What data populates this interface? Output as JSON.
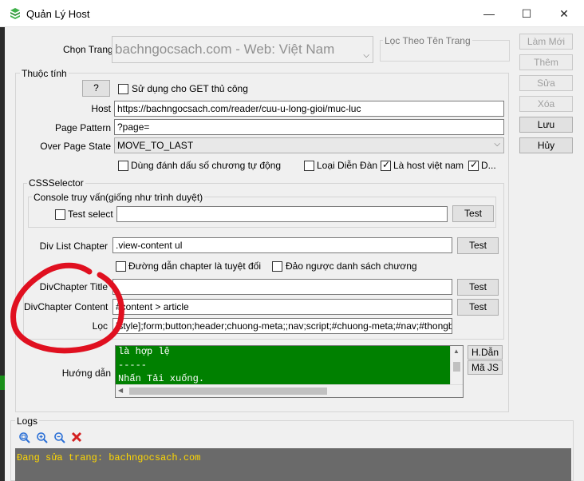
{
  "window": {
    "title": "Quản Lý Host",
    "minimize": "—",
    "maximize": "☐",
    "close": "✕"
  },
  "top": {
    "page_label": "Chọn Trang",
    "page_value": "bachngocsach.com - Web: Việt Nam",
    "filter_label": "Lọc Theo Tên Trang",
    "filter_value": ""
  },
  "side_buttons": {
    "new": "Làm Mới",
    "add": "Thêm",
    "edit": "Sửa",
    "delete": "Xóa",
    "save": "Lưu",
    "cancel": "Hủy"
  },
  "props": {
    "group_label": "Thuộc tính",
    "help_button": "?",
    "manual_get_label": "Sử dụng cho GET thủ công",
    "host_label": "Host",
    "host_value": "https://bachngocsach.com/reader/cuu-u-long-gioi/muc-luc",
    "page_pattern_label": "Page Pattern",
    "page_pattern_value": "?page=",
    "over_page_state_label": "Over Page State",
    "over_page_state_value": "MOVE_TO_LAST",
    "auto_number_label": "Dùng đánh dấu số chương tự động",
    "remove_forum_label": "Loại Diễn Đàn",
    "vn_host_label": "Là host việt nam",
    "d_label": "D..."
  },
  "css": {
    "group_label": "CSSSelector",
    "console_label": "Console truy vấn(giống như trình duyệt)",
    "test_select_label": "Test select",
    "test_select_value": "",
    "test_button": "Test",
    "div_list_label": "Div List Chapter",
    "div_list_value": ".view-content ul",
    "abs_path_label": "Đường dẫn chapter là tuyệt đối",
    "reverse_label": "Đảo ngược danh sách chương",
    "div_title_label": "DivChapter Title",
    "div_title_value": "",
    "div_content_label": "DivChapter Content",
    "div_content_value": "#content > article",
    "filter_label": "Lọc",
    "filter_value": "[style];form;button;header;chuong-meta;;nav;script;#chuong-meta;#nav;#thongbao"
  },
  "guide": {
    "label": "Hướng dẫn",
    "lines": [
      "là hợp lệ",
      "-----",
      "Nhấn Tải xuống."
    ],
    "hd_button": "H.Dẫn",
    "js_button": "Mã JS"
  },
  "logs": {
    "label": "Logs",
    "text": "Đang sửa trang: bachngocsach.com"
  },
  "colors": {
    "guide_bg": "#008000",
    "log_text": "#ffd800",
    "annotation": "#e01020"
  }
}
